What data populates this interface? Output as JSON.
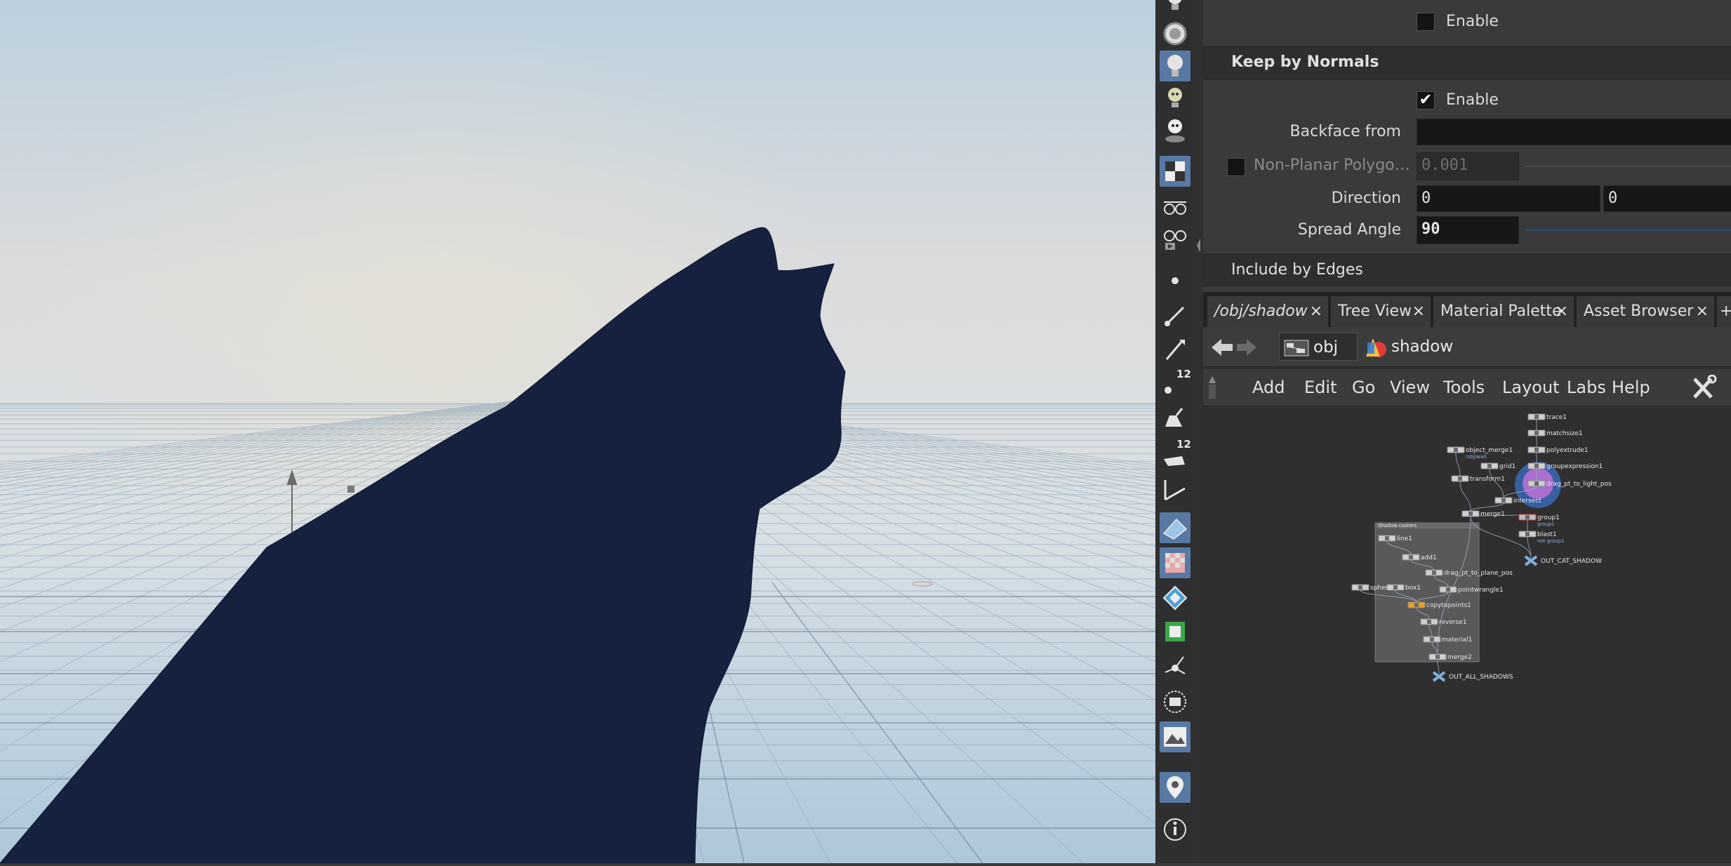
{
  "viewport": {
    "silhouette_color": "#16203f"
  },
  "shelf": {
    "tools": [
      {
        "icon": "light-bulb-icon"
      },
      {
        "icon": "portal-light-icon"
      },
      {
        "icon": "spot-light-icon",
        "active": true
      },
      {
        "icon": "env-light-icon"
      },
      {
        "icon": "sky-light-icon"
      },
      {
        "icon": "checker-display-icon",
        "active": true
      },
      {
        "icon": "ghost-glasses-icon"
      },
      {
        "icon": "glasses-render-icon"
      },
      {
        "icon": "point-icon"
      },
      {
        "icon": "brush-icon"
      },
      {
        "icon": "pen-icon"
      },
      {
        "icon": "point-count-icon",
        "label": "12"
      },
      {
        "icon": "fill-icon"
      },
      {
        "icon": "polygon-count-icon",
        "label": "12"
      },
      {
        "icon": "edge-angle-icon"
      },
      {
        "icon": "shaded-plane-icon",
        "active": true
      },
      {
        "icon": "checker-texture-icon",
        "active": true
      },
      {
        "icon": "uv-diamond-icon"
      },
      {
        "icon": "uv-frame-icon"
      },
      {
        "icon": "normals-icon"
      },
      {
        "icon": "safe-area-icon"
      },
      {
        "icon": "background-image-icon",
        "active": true
      },
      {
        "icon": "pin-icon",
        "active": true
      },
      {
        "icon": "info-icon"
      }
    ]
  },
  "params": {
    "enable_top_label": "Enable",
    "keep_by_normals_title": "Keep by Normals",
    "enable_label": "Enable",
    "enable_checkmark": "✔",
    "backface_from_label": "Backface from",
    "non_planar_label": "Non-Planar Polygo…",
    "non_planar_value": "0.001",
    "direction_label": "Direction",
    "direction_x": "0",
    "direction_y": "0",
    "spread_angle_label": "Spread Angle",
    "spread_angle_value": "90",
    "include_by_edges_title": "Include by Edges"
  },
  "tabs": [
    {
      "label": "/obj/shadow",
      "current": true
    },
    {
      "label": "Tree View"
    },
    {
      "label": "Material Palette"
    },
    {
      "label": "Asset Browser"
    }
  ],
  "tab_close": "×",
  "tab_add": "+",
  "path": {
    "obj": "obj",
    "shadow": "shadow"
  },
  "menu": [
    "Add",
    "Edit",
    "Go",
    "View",
    "Tools",
    "Layout",
    "Labs",
    "Help"
  ],
  "network": {
    "box_title": "Shadow casters",
    "nodes": [
      {
        "name": "trace1"
      },
      {
        "name": "matchsize1"
      },
      {
        "name": "polyextrude1"
      },
      {
        "name": "groupexpression1"
      },
      {
        "name": "drag_pt_to_light_pos"
      },
      {
        "name": "object_merge1",
        "sub": "/obj/wall"
      },
      {
        "name": "grid1"
      },
      {
        "name": "transform1"
      },
      {
        "name": "intersect"
      },
      {
        "name": "merge1"
      },
      {
        "name": "group1",
        "sub": "group1"
      },
      {
        "name": "blast1",
        "sub": "not group1"
      },
      {
        "name": "OUT_CAT_SHADOW"
      },
      {
        "name": "line1"
      },
      {
        "name": "add1"
      },
      {
        "name": "drag_pt_to_plane_pos"
      },
      {
        "name": "sphere1"
      },
      {
        "name": "box1"
      },
      {
        "name": "pointwrangle1"
      },
      {
        "name": "copytopoints1"
      },
      {
        "name": "reverse1"
      },
      {
        "name": "material1"
      },
      {
        "name": "merge2"
      },
      {
        "name": "OUT_ALL_SHADOWS"
      }
    ]
  }
}
